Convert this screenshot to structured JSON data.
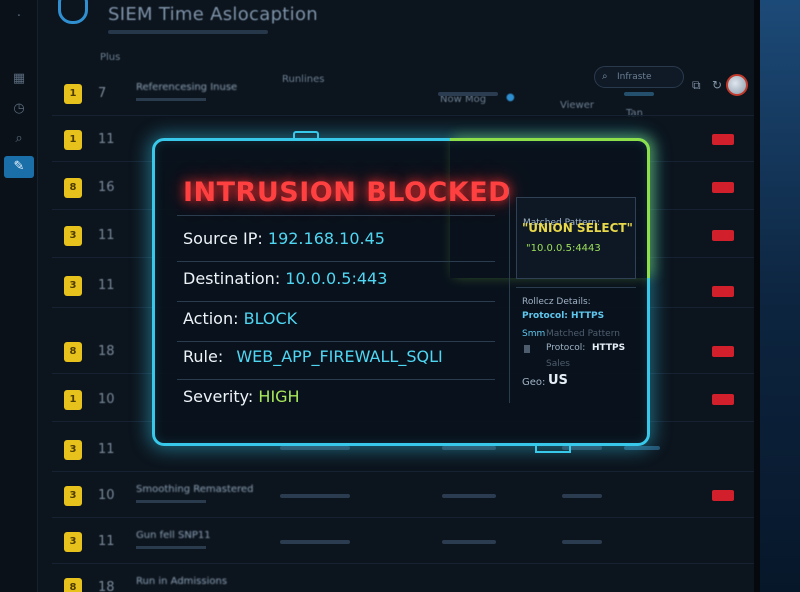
{
  "app": {
    "title": "SIEM Time Aslocaption"
  },
  "columns": {
    "plus": "Plus",
    "runlines": "Runlines",
    "now": "Now Mog",
    "viewer": "Viewer",
    "tan": "Tan"
  },
  "search": {
    "placeholder": "Infraste"
  },
  "rows": [
    {
      "num": "7",
      "desc": "Referencesing Inuse"
    },
    {
      "num": "11",
      "desc": ""
    },
    {
      "num": "16",
      "desc": ""
    },
    {
      "num": "11",
      "desc": ""
    },
    {
      "num": "11",
      "desc": ""
    },
    {
      "num": "18",
      "desc": ""
    },
    {
      "num": "10",
      "desc": ""
    },
    {
      "num": "11",
      "desc": ""
    },
    {
      "num": "10",
      "desc": "Smoothing Remastered"
    },
    {
      "num": "11",
      "desc": "Gun fell SNP11"
    },
    {
      "num": "18",
      "desc": "Run in Admissions"
    }
  ],
  "alert": {
    "title": "INTRUSION BLOCKED",
    "source_ip_label": "Source IP:",
    "source_ip": "192.168.10.45",
    "destination_label": "Destination:",
    "destination": "10.0.0.5:443",
    "action_label": "Action:",
    "action": "BLOCK",
    "rule_label": "Rule:",
    "rule": "WEB_APP_FIREWALL_SQLI",
    "severity_label": "Severity:",
    "severity": "HIGH"
  },
  "details": {
    "matched_pattern_label": "Matched Pattern:",
    "matched_pattern": "\"UNION SELECT\"",
    "matched_target": "\"10.0.0.5:4443",
    "details_label": "Rollecz Details:",
    "protocol_line": "Protocol: HTTPS",
    "sim_label": "Smm",
    "matched_pattern_dim": "Matched Pattern",
    "protocol_label": "Protocol:",
    "protocol_value": "HTTPS",
    "sales_label": "Sales",
    "geo_label": "Geo:",
    "geo_value": "US"
  },
  "icons": [
    "shield-logo",
    "search-icon",
    "grid-icon",
    "history-icon",
    "alert-icon",
    "zoom-icon",
    "wrench-icon",
    "filter-icon",
    "refresh-icon",
    "settings-icon"
  ],
  "colors": {
    "alert_border": "#38c8ea",
    "alert_title": "#ff4040",
    "badge": "#e8c21c",
    "status_red": "#d11f2b",
    "accent_green": "#8ee04a"
  }
}
